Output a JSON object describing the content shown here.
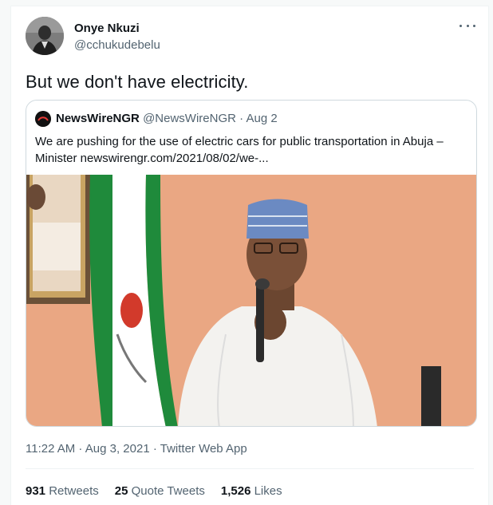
{
  "tweet": {
    "author": {
      "name": "Onye Nkuzi",
      "handle": "@cchukudebelu"
    },
    "text": "But we don't have electricity.",
    "timestamp": "11:22 AM · Aug 3, 2021 · Twitter Web App",
    "more_icon": "more-horizontal-icon"
  },
  "quoted": {
    "name": "NewsWireNGR",
    "handle": "@NewsWireNGR",
    "date_sep": " · ",
    "date": "Aug 2",
    "text": "We are pushing for the use of electric cars for public transportation in Abuja – Minister newswirengr.com/2021/08/02/we-..."
  },
  "stats": {
    "retweets": {
      "count": "931",
      "label": "Retweets"
    },
    "quotes": {
      "count": "25",
      "label": "Quote Tweets"
    },
    "likes": {
      "count": "1,526",
      "label": "Likes"
    }
  },
  "colors": {
    "text": "#0f1419",
    "secondary": "#536471",
    "border": "#cfd9de",
    "flag_green": "#1f8a3b",
    "wall": "#e9a27e"
  }
}
